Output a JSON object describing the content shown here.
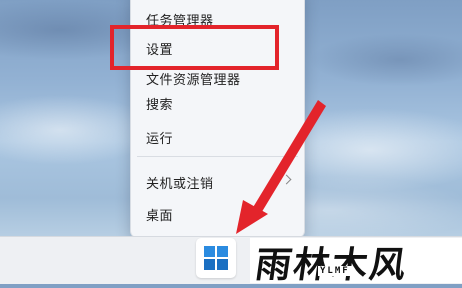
{
  "context_menu": {
    "items": [
      {
        "label": "任务管理器"
      },
      {
        "label": "设置"
      },
      {
        "label": "文件资源管理器"
      },
      {
        "label": "搜索"
      },
      {
        "label": "运行"
      },
      {
        "label": "关机或注销"
      },
      {
        "label": "桌面"
      }
    ]
  },
  "annotations": {
    "highlight_color": "#e3242b",
    "arrow_color": "#e3242b"
  },
  "taskbar": {
    "start_icon": "windows-logo-icon",
    "accent_color": "#1e7fd6"
  },
  "watermark": {
    "brand": "雨林木风",
    "sub": "YLMF"
  }
}
